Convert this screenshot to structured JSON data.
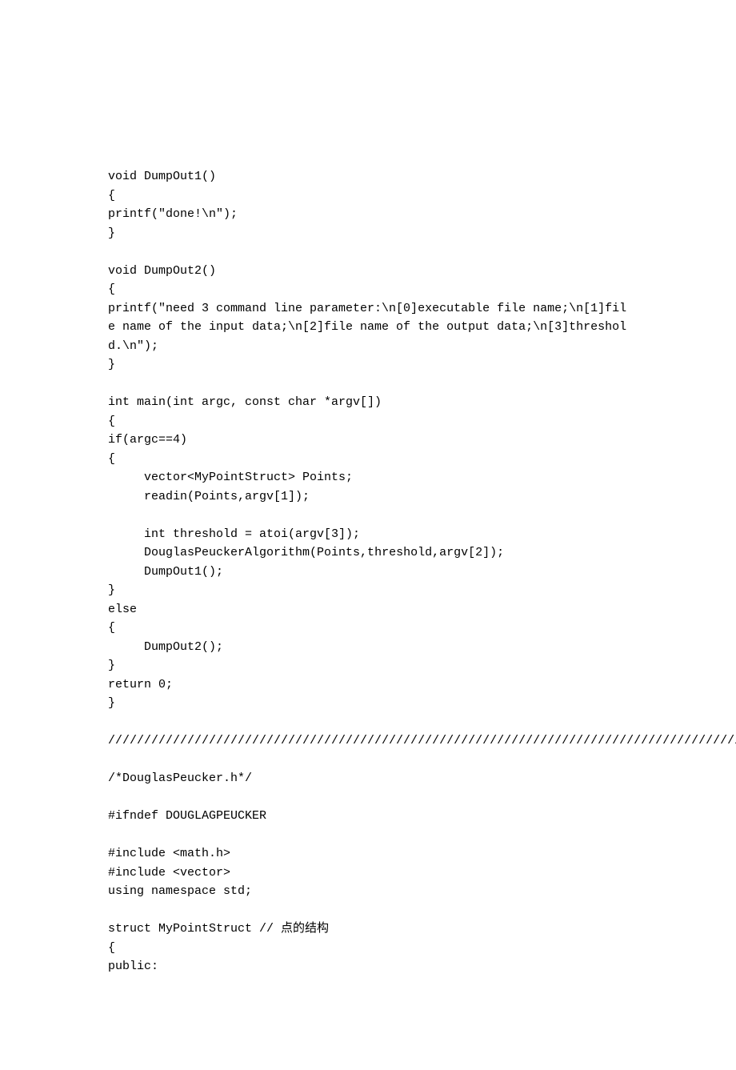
{
  "lines": [
    "void DumpOut1()",
    "{",
    "printf(\"done!\\n\");",
    "}",
    "",
    "void DumpOut2()",
    "{",
    "printf(\"need 3 command line parameter:\\n[0]executable file name;\\n[1]file name of the input data;\\n[2]file name of the output data;\\n[3]threshold.\\n\");",
    "}",
    "",
    "int main(int argc, const char *argv[])",
    "{",
    "if(argc==4)",
    "{",
    "     vector<MyPointStruct> Points;",
    "     readin(Points,argv[1]);",
    "",
    "     int threshold = atoi(argv[3]);",
    "     DouglasPeuckerAlgorithm(Points,threshold,argv[2]);",
    "     DumpOut1();",
    "}",
    "else",
    "{",
    "     DumpOut2();",
    "}",
    "return 0;",
    "}",
    "",
    "//////////////////////////////////////////////////////////////////////////////////////////////////////////////////////////////////////////////////////////",
    "",
    "/*DouglasPeucker.h*/",
    "",
    "#ifndef DOUGLAGPEUCKER",
    "",
    "#include <math.h>",
    "#include <vector>",
    "using namespace std;",
    "",
    "struct MyPointStruct // 点的结构",
    "{",
    "public:"
  ]
}
